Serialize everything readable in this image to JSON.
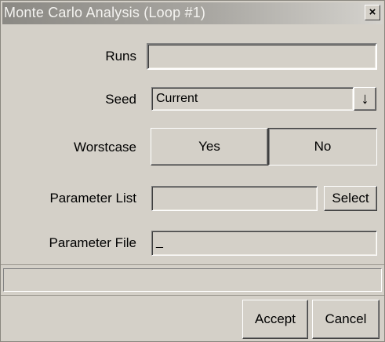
{
  "window": {
    "title": "Monte Carlo Analysis (Loop #1)",
    "close_label": "×"
  },
  "form": {
    "runs_label": "Runs",
    "runs_value": "",
    "seed_label": "Seed",
    "seed_value": "Current",
    "seed_dropdown_glyph": "↓",
    "worstcase_label": "Worstcase",
    "worstcase_yes": "Yes",
    "worstcase_no": "No",
    "worstcase_selected": "No",
    "param_list_label": "Parameter List",
    "param_list_value": "",
    "select_label": "Select",
    "param_file_label": "Parameter File",
    "param_file_value": "_"
  },
  "status": {
    "text": ""
  },
  "footer": {
    "accept_label": "Accept",
    "cancel_label": "Cancel"
  }
}
